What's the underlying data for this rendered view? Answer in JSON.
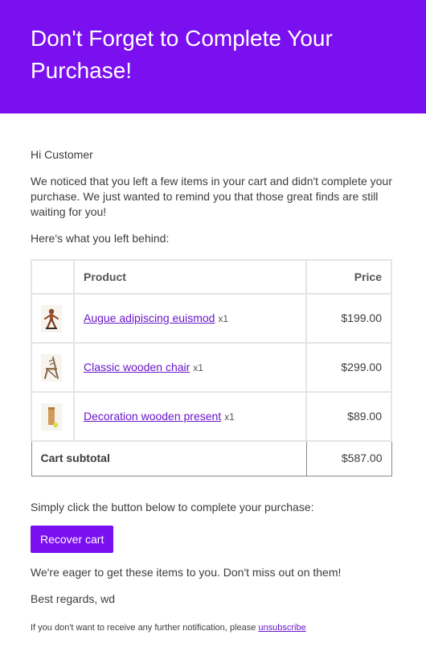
{
  "colors": {
    "brand": "#7a0ff0",
    "link": "#6a16c9",
    "text": "#3c3c3c",
    "border": "#e5e5e5"
  },
  "header": {
    "title": "Don't Forget to Complete Your Purchase!"
  },
  "body": {
    "greeting": "Hi Customer",
    "intro": "We noticed that you left a few items in your cart and didn't complete your purchase. We just wanted to remind you that those great finds are still waiting for you!",
    "left_behind": "Here's what you left behind:"
  },
  "cart": {
    "headers": {
      "product": "Product",
      "price": "Price"
    },
    "items": [
      {
        "name": "Augue adipiscing euismod",
        "qty": "x1",
        "price": "$199.00",
        "icon": "wooden-figure-thumbnail"
      },
      {
        "name": "Classic wooden chair",
        "qty": "x1",
        "price": "$299.00",
        "icon": "wooden-chair-thumbnail"
      },
      {
        "name": "Decoration wooden present",
        "qty": "x1",
        "price": "$89.00",
        "icon": "wooden-present-thumbnail"
      }
    ],
    "subtotal_label": "Cart subtotal",
    "subtotal_value": "$587.00"
  },
  "cta": {
    "text": "Simply click the button below to complete your purchase:",
    "button_label": "Recover cart"
  },
  "closing": {
    "eager": "We're eager to get these items to you. Don't miss out on them!",
    "regards": "Best regards, wd"
  },
  "footer": {
    "note": "If you don't want to receive any further notification, please ",
    "unsubscribe_label": "unsubscribe"
  }
}
